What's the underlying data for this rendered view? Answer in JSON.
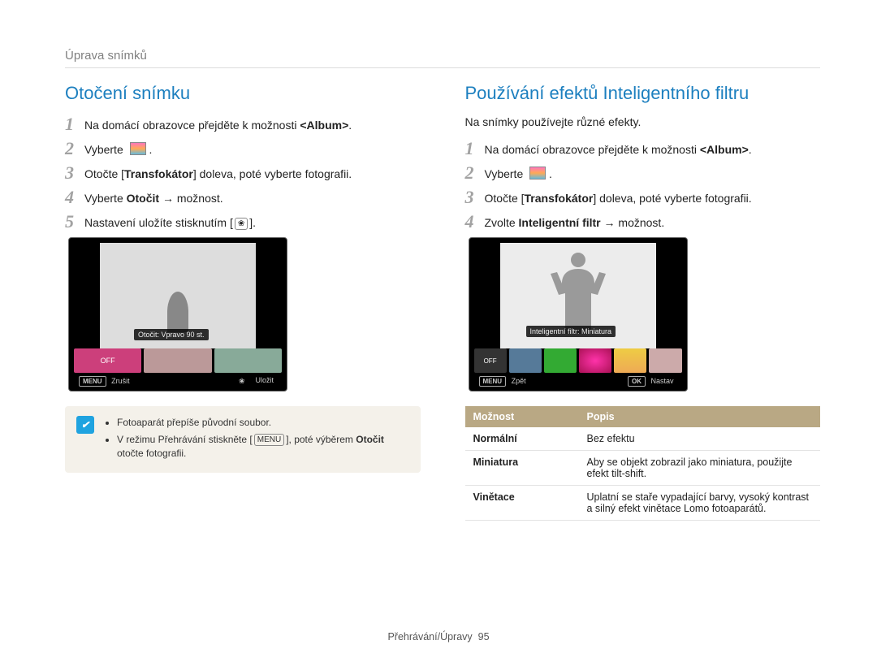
{
  "breadcrumb": "Úprava snímků",
  "left": {
    "heading": "Otočení snímku",
    "steps": [
      {
        "n": "1",
        "pre": "Na domácí obrazovce přejděte k možnosti ",
        "b": "<Album>",
        "post": "."
      },
      {
        "n": "2",
        "pre": "Vyberte",
        "b": "",
        "post": "",
        "icon": true
      },
      {
        "n": "3",
        "pre": "Otočte [",
        "b": "Transfokátor",
        "post": "] doleva, poté vyberte fotografii."
      },
      {
        "n": "4",
        "pre": "Vyberte ",
        "b": "Otočit",
        "post": " → možnost."
      },
      {
        "n": "5",
        "pre": "Nastavení uložíte stisknutím [",
        "b": "",
        "post": "].",
        "macro_icon": true
      }
    ],
    "cam": {
      "label": "Otočit: Vpravo 90 st.",
      "foot_left": "Zrušit",
      "foot_right": "Uložit",
      "menu": "MENU"
    },
    "info": {
      "items": [
        "Fotoaparát přepíše původní soubor.",
        "V režimu Přehrávání stiskněte [ m ], poté výběrem Otočit otočte fotografii."
      ],
      "menu_word": "MENU",
      "bold": "Otočit"
    }
  },
  "right": {
    "heading": "Používání efektů Inteligentního filtru",
    "intro": "Na snímky používejte různé efekty.",
    "steps": [
      {
        "n": "1",
        "pre": "Na domácí obrazovce přejděte k možnosti ",
        "b": "<Album>",
        "post": "."
      },
      {
        "n": "2",
        "pre": "Vyberte",
        "b": "",
        "post": "",
        "icon": true
      },
      {
        "n": "3",
        "pre": "Otočte [",
        "b": "Transfokátor",
        "post": "] doleva, poté vyberte fotografii."
      },
      {
        "n": "4",
        "pre": "Zvolte ",
        "b": "Inteligentní filtr",
        "post": " → možnost."
      }
    ],
    "cam": {
      "label": "Inteligentní filtr: Miniatura",
      "foot_left": "Zpět",
      "foot_right": "Nastav",
      "menu": "MENU",
      "ok": "OK",
      "off": "OFF"
    },
    "table": {
      "hdr_option": "Možnost",
      "hdr_desc": "Popis",
      "rows": [
        {
          "name": "Normální",
          "desc": "Bez efektu"
        },
        {
          "name": "Miniatura",
          "desc": "Aby se objekt zobrazil jako miniatura, použijte efekt tilt-shift."
        },
        {
          "name": "Vinětace",
          "desc": "Uplatní se staře vypadající barvy, vysoký kontrast a silný efekt vinětace Lomo fotoaparátů."
        }
      ]
    }
  },
  "footer": {
    "label": "Přehrávání/Úpravy",
    "page": "95"
  }
}
